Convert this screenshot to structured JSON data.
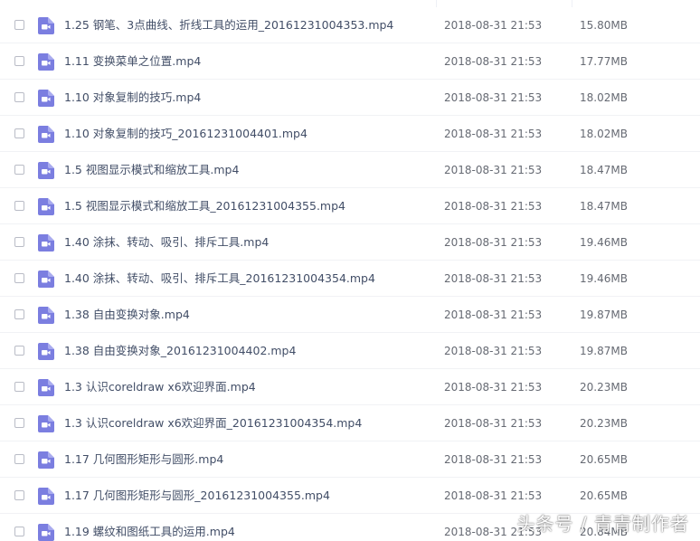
{
  "colors": {
    "accent": "#7b7ee0",
    "text": "#424e67",
    "meta": "#666a73"
  },
  "icon": "video-file-icon",
  "files": [
    {
      "name": "1.25 钢笔、3点曲线、折线工具的运用_20161231004353.mp4",
      "date": "2018-08-31 21:53",
      "size": "15.80MB"
    },
    {
      "name": "1.11 变换菜单之位置.mp4",
      "date": "2018-08-31 21:53",
      "size": "17.77MB"
    },
    {
      "name": "1.10 对象复制的技巧.mp4",
      "date": "2018-08-31 21:53",
      "size": "18.02MB"
    },
    {
      "name": "1.10 对象复制的技巧_20161231004401.mp4",
      "date": "2018-08-31 21:53",
      "size": "18.02MB"
    },
    {
      "name": "1.5 视图显示模式和缩放工具.mp4",
      "date": "2018-08-31 21:53",
      "size": "18.47MB"
    },
    {
      "name": "1.5 视图显示模式和缩放工具_20161231004355.mp4",
      "date": "2018-08-31 21:53",
      "size": "18.47MB"
    },
    {
      "name": "1.40 涂抹、转动、吸引、排斥工具.mp4",
      "date": "2018-08-31 21:53",
      "size": "19.46MB"
    },
    {
      "name": "1.40 涂抹、转动、吸引、排斥工具_20161231004354.mp4",
      "date": "2018-08-31 21:53",
      "size": "19.46MB"
    },
    {
      "name": "1.38 自由变换对象.mp4",
      "date": "2018-08-31 21:53",
      "size": "19.87MB"
    },
    {
      "name": "1.38 自由变换对象_20161231004402.mp4",
      "date": "2018-08-31 21:53",
      "size": "19.87MB"
    },
    {
      "name": "1.3 认识coreldraw x6欢迎界面.mp4",
      "date": "2018-08-31 21:53",
      "size": "20.23MB"
    },
    {
      "name": "1.3 认识coreldraw x6欢迎界面_20161231004354.mp4",
      "date": "2018-08-31 21:53",
      "size": "20.23MB"
    },
    {
      "name": "1.17 几何图形矩形与圆形.mp4",
      "date": "2018-08-31 21:53",
      "size": "20.65MB"
    },
    {
      "name": "1.17 几何图形矩形与圆形_20161231004355.mp4",
      "date": "2018-08-31 21:53",
      "size": "20.65MB"
    },
    {
      "name": "1.19 螺纹和图纸工具的运用.mp4",
      "date": "2018-08-31 21:53",
      "size": "20.84MB"
    }
  ],
  "watermark": "头条号 / 青青制作者"
}
